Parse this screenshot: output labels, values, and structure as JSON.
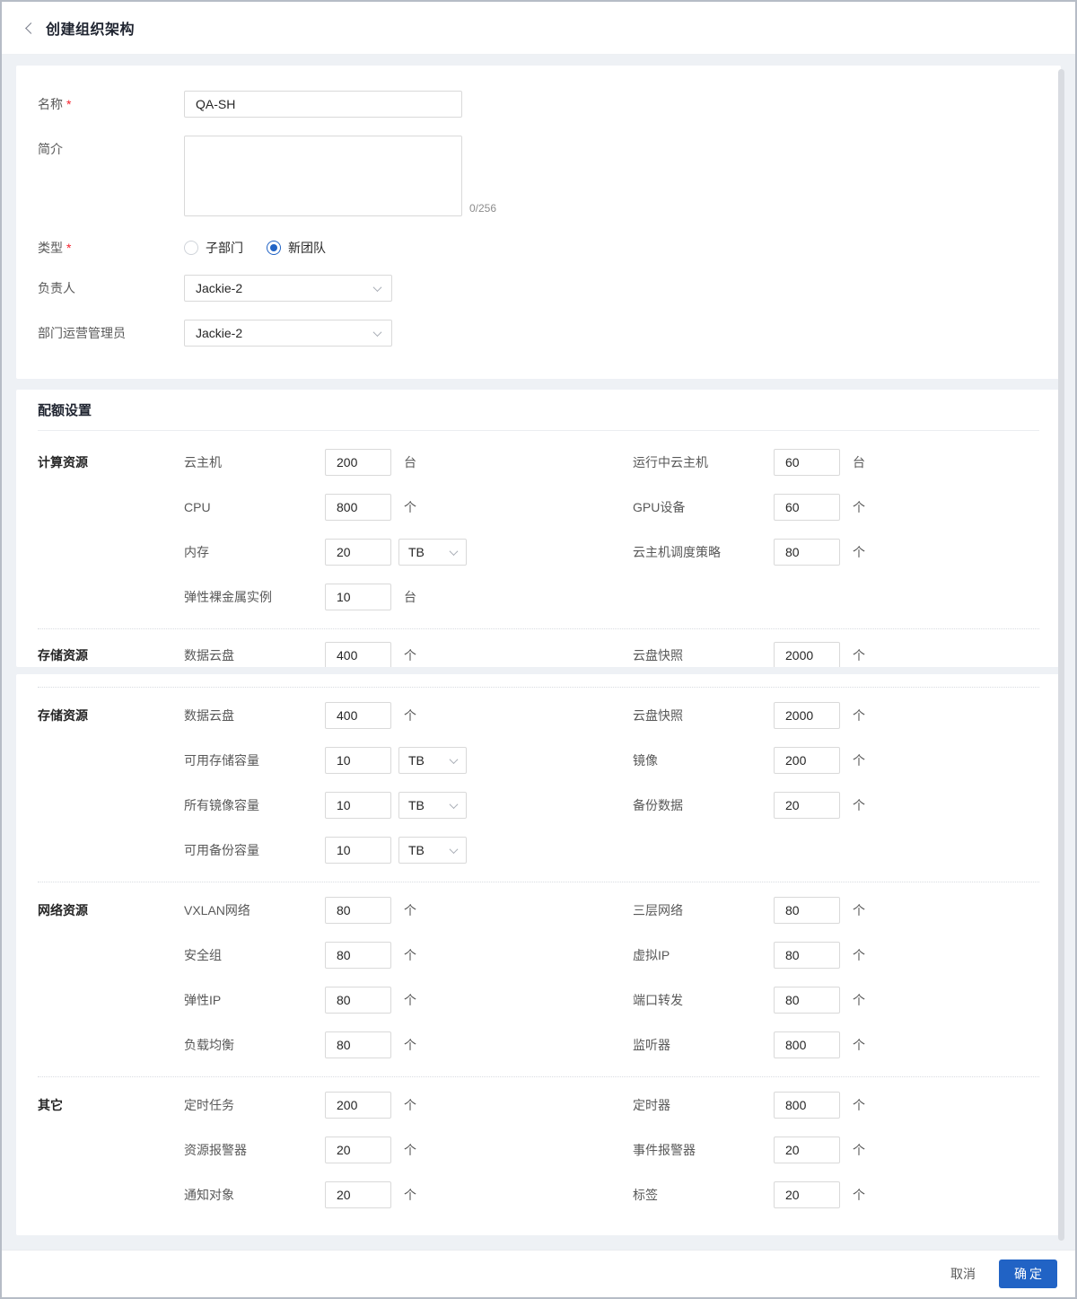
{
  "colors": {
    "accent": "#2163c5",
    "danger": "#f5222d"
  },
  "header": {
    "title": "创建组织架构"
  },
  "form": {
    "name": {
      "label": "名称",
      "required_mark": "*",
      "value": "QA-SH"
    },
    "intro": {
      "label": "简介",
      "value": "",
      "counter": "0/256"
    },
    "type": {
      "label": "类型",
      "required_mark": "*",
      "options": [
        {
          "label": "子部门",
          "selected": false
        },
        {
          "label": "新团队",
          "selected": true
        }
      ]
    },
    "owner": {
      "label": "负责人",
      "value": "Jackie-2"
    },
    "admin": {
      "label": "部门运营管理员",
      "value": "Jackie-2"
    }
  },
  "quota": {
    "title": "配额设置",
    "cards": [
      {
        "has_title": true,
        "groups": [
          {
            "label": "计算资源",
            "divider": false,
            "partial": false,
            "rows": [
              {
                "left": {
                  "label": "云主机",
                  "value": "200",
                  "unit": "台"
                },
                "right": {
                  "label": "运行中云主机",
                  "value": "60",
                  "unit": "台"
                }
              },
              {
                "left": {
                  "label": "CPU",
                  "value": "800",
                  "unit": "个"
                },
                "right": {
                  "label": "GPU设备",
                  "value": "60",
                  "unit": "个"
                }
              },
              {
                "left": {
                  "label": "内存",
                  "value": "20",
                  "select": "TB"
                },
                "right": {
                  "label": "云主机调度策略",
                  "value": "80",
                  "unit": "个"
                }
              },
              {
                "left": {
                  "label": "弹性裸金属实例",
                  "value": "10",
                  "unit": "台"
                }
              }
            ]
          },
          {
            "label": "存储资源",
            "divider": true,
            "partial": true,
            "rows": [
              {
                "left": {
                  "label": "数据云盘",
                  "value": "400",
                  "unit": "个"
                },
                "right": {
                  "label": "云盘快照",
                  "value": "2000",
                  "unit": "个"
                }
              }
            ]
          }
        ]
      },
      {
        "has_title": false,
        "groups": [
          {
            "label": "存储资源",
            "divider": true,
            "partial": false,
            "rows": [
              {
                "left": {
                  "label": "数据云盘",
                  "value": "400",
                  "unit": "个"
                },
                "right": {
                  "label": "云盘快照",
                  "value": "2000",
                  "unit": "个"
                }
              },
              {
                "left": {
                  "label": "可用存储容量",
                  "value": "10",
                  "select": "TB"
                },
                "right": {
                  "label": "镜像",
                  "value": "200",
                  "unit": "个"
                }
              },
              {
                "left": {
                  "label": "所有镜像容量",
                  "value": "10",
                  "select": "TB"
                },
                "right": {
                  "label": "备份数据",
                  "value": "20",
                  "unit": "个"
                }
              },
              {
                "left": {
                  "label": "可用备份容量",
                  "value": "10",
                  "select": "TB"
                }
              }
            ]
          },
          {
            "label": "网络资源",
            "divider": true,
            "partial": false,
            "rows": [
              {
                "left": {
                  "label": "VXLAN网络",
                  "value": "80",
                  "unit": "个"
                },
                "right": {
                  "label": "三层网络",
                  "value": "80",
                  "unit": "个"
                }
              },
              {
                "left": {
                  "label": "安全组",
                  "value": "80",
                  "unit": "个"
                },
                "right": {
                  "label": "虚拟IP",
                  "value": "80",
                  "unit": "个"
                }
              },
              {
                "left": {
                  "label": "弹性IP",
                  "value": "80",
                  "unit": "个"
                },
                "right": {
                  "label": "端口转发",
                  "value": "80",
                  "unit": "个"
                }
              },
              {
                "left": {
                  "label": "负载均衡",
                  "value": "80",
                  "unit": "个"
                },
                "right": {
                  "label": "监听器",
                  "value": "800",
                  "unit": "个"
                }
              }
            ]
          },
          {
            "label": "其它",
            "divider": true,
            "partial": false,
            "rows": [
              {
                "left": {
                  "label": "定时任务",
                  "value": "200",
                  "unit": "个"
                },
                "right": {
                  "label": "定时器",
                  "value": "800",
                  "unit": "个"
                }
              },
              {
                "left": {
                  "label": "资源报警器",
                  "value": "20",
                  "unit": "个"
                },
                "right": {
                  "label": "事件报警器",
                  "value": "20",
                  "unit": "个"
                }
              },
              {
                "left": {
                  "label": "通知对象",
                  "value": "20",
                  "unit": "个"
                },
                "right": {
                  "label": "标签",
                  "value": "20",
                  "unit": "个"
                }
              }
            ]
          }
        ]
      }
    ]
  },
  "footer": {
    "cancel_label": "取消",
    "confirm_label": "确定"
  }
}
